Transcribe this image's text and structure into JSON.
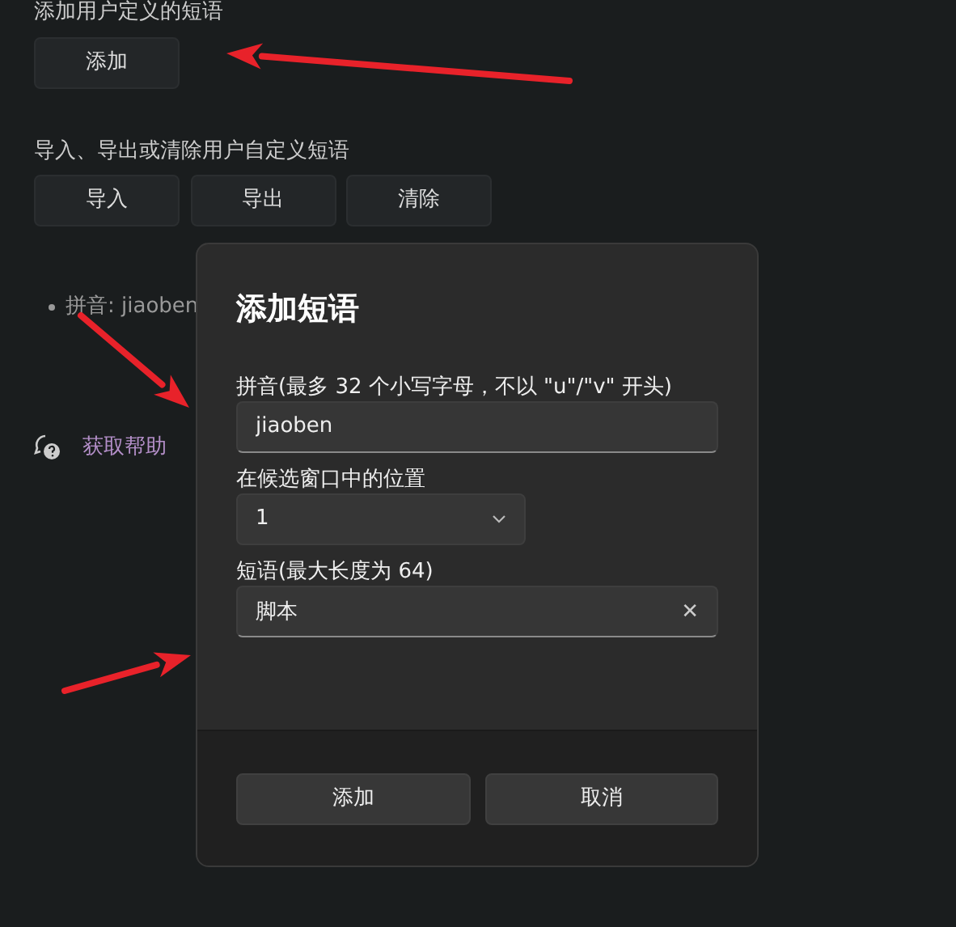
{
  "settings": {
    "add_section": {
      "heading": "添加用户定义的短语",
      "button": "添加"
    },
    "manage_section": {
      "heading": "导入、导出或清除用户自定义短语",
      "buttons": [
        "导入",
        "导出",
        "清除"
      ]
    },
    "phrases": [
      {
        "text": "拼音: jiaoben"
      }
    ],
    "help_link": "获取帮助"
  },
  "dialog": {
    "title": "添加短语",
    "fields": [
      {
        "kind": "text",
        "label": "拼音(最多 32 个小写字母，不以 \"u\"/\"v\" 开头)",
        "value": "jiaoben"
      },
      {
        "kind": "select",
        "label": "在候选窗口中的位置",
        "value": "1"
      },
      {
        "kind": "clearable",
        "label": "短语(最大长度为 64)",
        "value": "脚本",
        "clear": "✕"
      }
    ],
    "buttons": [
      "添加",
      "取消"
    ]
  }
}
